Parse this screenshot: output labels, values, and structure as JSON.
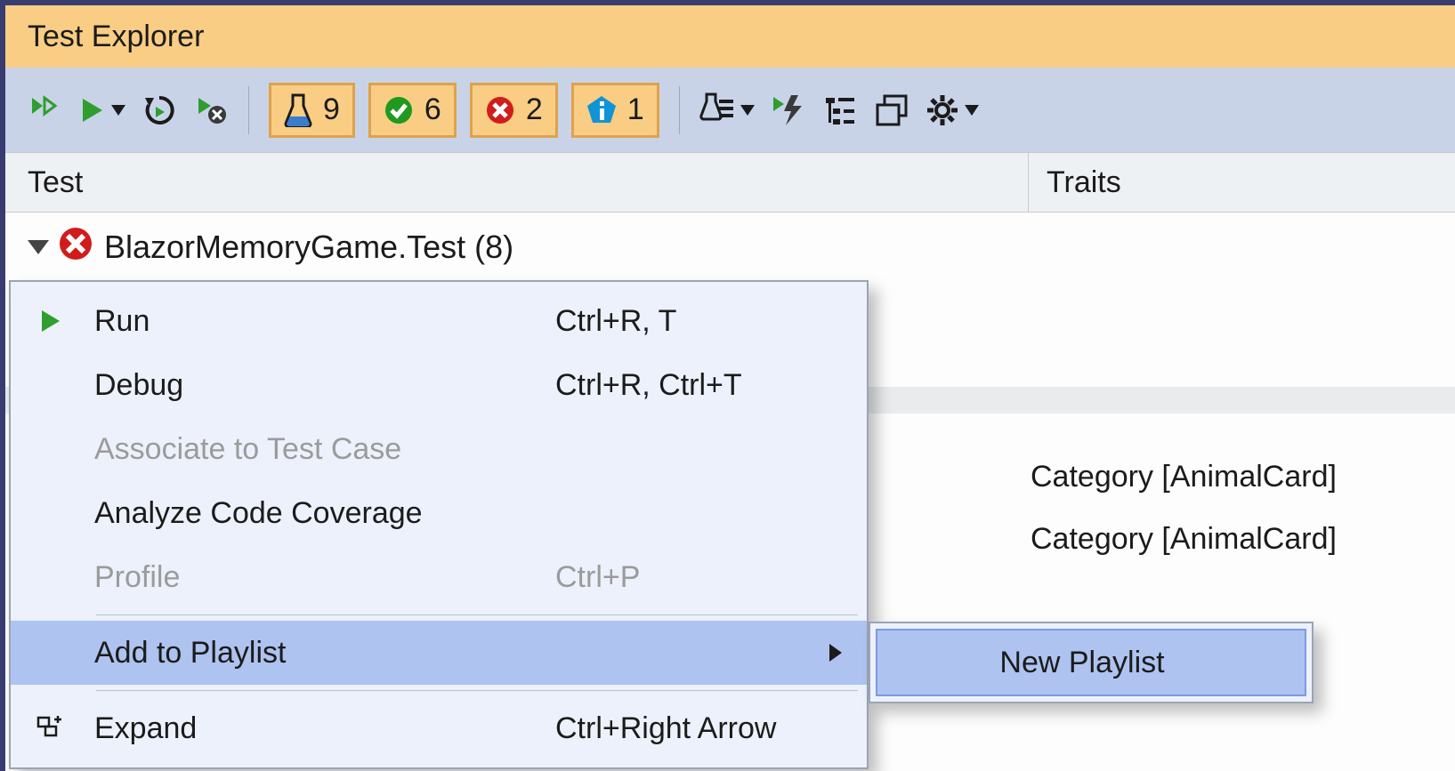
{
  "title": "Test Explorer",
  "columns": {
    "test": "Test",
    "traits": "Traits"
  },
  "stats": {
    "total": "9",
    "passed": "6",
    "failed": "2",
    "info": "1"
  },
  "tree": {
    "root_label": "BlazorMemoryGame.Test  (8)"
  },
  "traits": {
    "line1": "Category [AnimalCard]",
    "line2": "Category [AnimalCard]"
  },
  "context_menu": {
    "run": "Run",
    "run_sc": "Ctrl+R, T",
    "debug": "Debug",
    "debug_sc": "Ctrl+R, Ctrl+T",
    "associate": "Associate to Test Case",
    "coverage": "Analyze Code Coverage",
    "profile": "Profile",
    "profile_sc": "Ctrl+P",
    "playlist": "Add to Playlist",
    "expand": "Expand",
    "expand_sc": "Ctrl+Right Arrow"
  },
  "submenu": {
    "new_playlist": "New Playlist"
  }
}
